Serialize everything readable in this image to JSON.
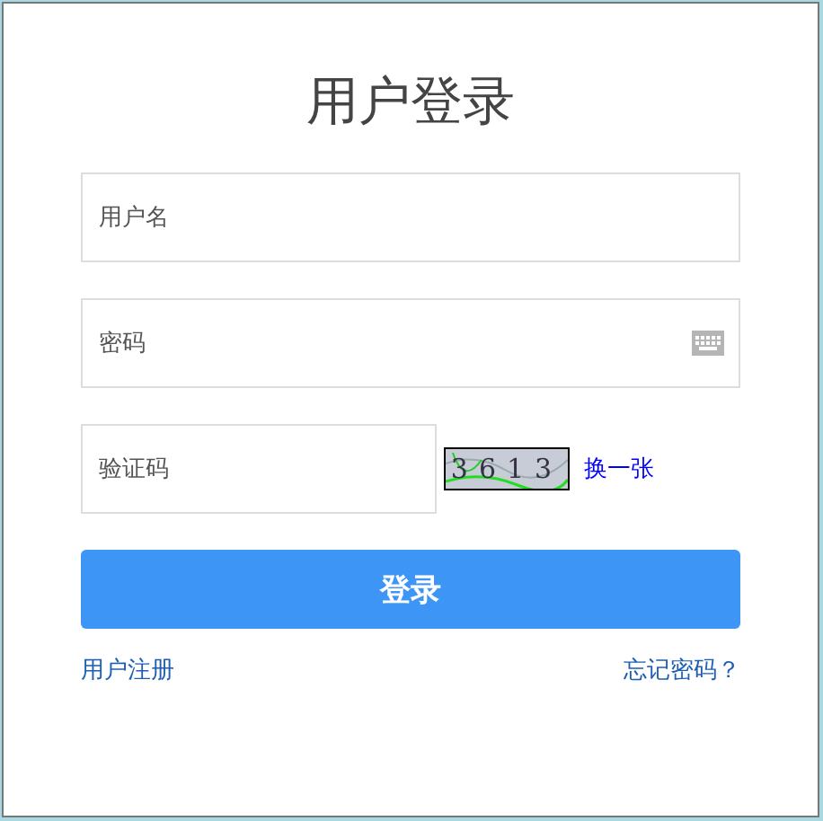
{
  "title": "用户登录",
  "fields": [
    {
      "kind": "text",
      "placeholder": "用户名"
    },
    {
      "kind": "password",
      "placeholder": "密码"
    }
  ],
  "captcha": {
    "placeholder": "验证码",
    "code": "3613",
    "refresh": "换一张"
  },
  "submit": "登录",
  "links": {
    "register": "用户注册",
    "forgot": "忘记密码？"
  }
}
